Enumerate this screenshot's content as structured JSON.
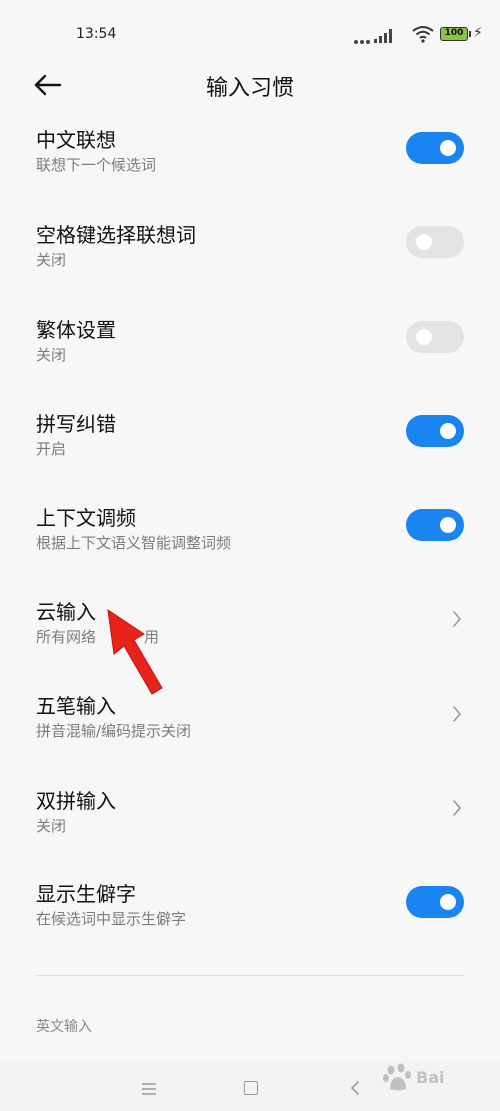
{
  "status_bar": {
    "time": "13:54",
    "battery": "100"
  },
  "header": {
    "title": "输入习惯"
  },
  "items": [
    {
      "title": "中文联想",
      "subtitle": "联想下一个候选词",
      "control": "toggle",
      "enabled": true
    },
    {
      "title": "空格键选择联想词",
      "subtitle": "关闭",
      "control": "toggle",
      "enabled": false
    },
    {
      "title": "繁体设置",
      "subtitle": "关闭",
      "control": "toggle",
      "enabled": false
    },
    {
      "title": "拼写纠错",
      "subtitle": "开启",
      "control": "toggle",
      "enabled": true
    },
    {
      "title": "上下文调频",
      "subtitle": "根据上下文语义智能调整词频",
      "control": "toggle",
      "enabled": true
    },
    {
      "title": "云输入",
      "subtitle": "所有网络",
      "subtitle_tail": "用",
      "control": "chevron"
    },
    {
      "title": "五笔输入",
      "subtitle": "拼音混输/编码提示关闭",
      "control": "chevron"
    },
    {
      "title": "双拼输入",
      "subtitle": "关闭",
      "control": "chevron"
    },
    {
      "title": "显示生僻字",
      "subtitle": "在候选词中显示生僻字",
      "control": "toggle",
      "enabled": true
    }
  ],
  "section": {
    "label": "英文输入"
  },
  "watermark": {
    "text": "Bai"
  },
  "colors": {
    "accent": "#1a84f0",
    "toggle_off": "#e3e3e3",
    "annotation_arrow": "#e8231c"
  },
  "icons": [
    "back-arrow-icon",
    "chevron-right-icon",
    "wifi-icon",
    "signal-icon",
    "battery-icon",
    "menu-icon",
    "home-icon",
    "nav-back-icon"
  ]
}
